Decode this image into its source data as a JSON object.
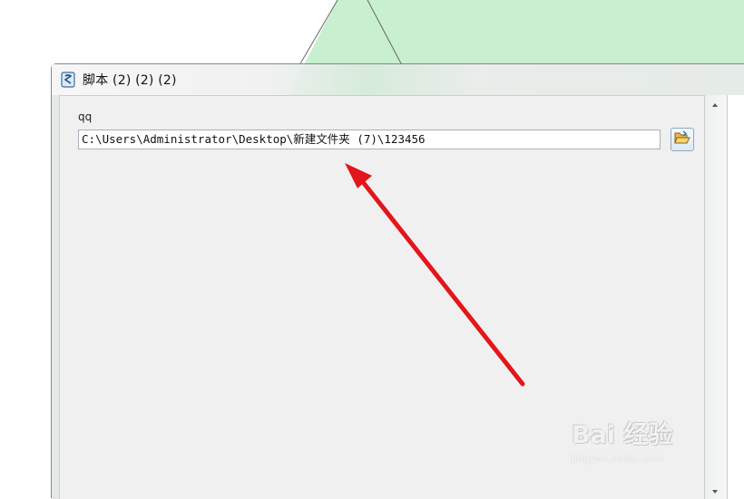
{
  "window": {
    "title": "脚本 (2) (2) (2)",
    "icon": "script-scroll-icon"
  },
  "form": {
    "param_label": "qq",
    "path_value": "C:\\Users\\Administrator\\Desktop\\新建文件夹 (7)\\123456",
    "browse_icon": "open-folder-icon"
  },
  "annotation": {
    "arrow_color": "#e3161b"
  },
  "watermark": {
    "brand": "Bai 经验",
    "site": "jingyan.baidu.com"
  },
  "colors": {
    "desktop_green": "#c8efcf",
    "dialog_body": "#f0f0f0"
  }
}
